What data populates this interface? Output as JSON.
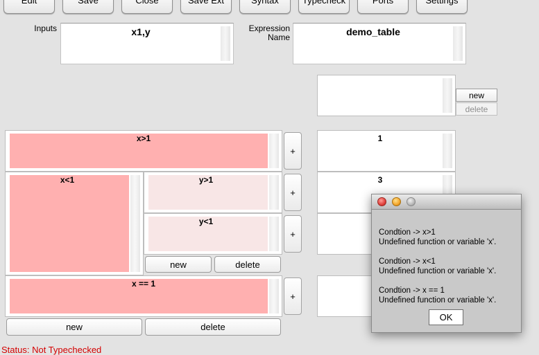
{
  "toolbar": {
    "buttons": [
      "Edit",
      "Save",
      "Close",
      "Save Ext",
      "Syntax",
      "Typecheck",
      "Ports",
      "Settings"
    ]
  },
  "header": {
    "inputs_label": "Inputs",
    "inputs_value": "x1,y",
    "expr_label_line1": "Expression",
    "expr_label_line2": "Name",
    "expr_value": "demo_table"
  },
  "output_panel": {
    "new_label": "new",
    "delete_label": "delete"
  },
  "table": {
    "conditions": {
      "row1": "x>1",
      "row2": "x<1",
      "row2_sub1": "y>1",
      "row2_sub2": "y<1",
      "row3": "x == 1"
    },
    "plus_label": "+",
    "sub_new_label": "new",
    "sub_delete_label": "delete",
    "bottom_new_label": "new",
    "bottom_delete_label": "delete",
    "outputs": [
      "1",
      "3",
      "",
      ""
    ]
  },
  "status": "Status: Not Typechecked",
  "dialog": {
    "messages": [
      {
        "line1": "Condtion -> x>1",
        "line2": "Undefined function or variable 'x'."
      },
      {
        "line1": "Condtion -> x<1",
        "line2": "Undefined function or variable 'x'."
      },
      {
        "line1": "Condtion -> x == 1",
        "line2": "Undefined function or variable 'x'."
      }
    ],
    "ok_label": "OK",
    "colors": {
      "close": "#e0413c",
      "minimize": "#f4a52c",
      "zoom": "#b8b8b8"
    }
  }
}
